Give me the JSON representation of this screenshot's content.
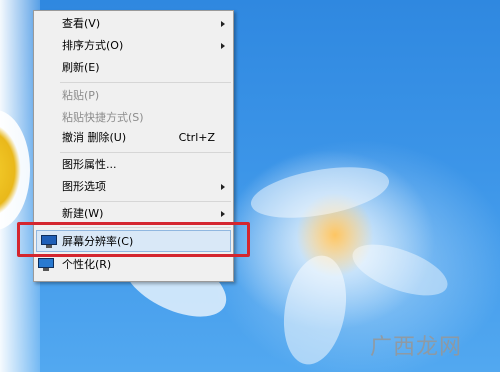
{
  "menu": {
    "items": [
      {
        "label": "查看(V)",
        "submenu": true
      },
      {
        "label": "排序方式(O)",
        "submenu": true
      },
      {
        "label": "刷新(E)"
      },
      {
        "label": "粘贴(P)",
        "disabled": true
      },
      {
        "label": "粘贴快捷方式(S)",
        "disabled": true
      },
      {
        "label": "撤消 删除(U)",
        "shortcut": "Ctrl+Z"
      },
      {
        "label": "图形属性..."
      },
      {
        "label": "图形选项",
        "submenu": true
      },
      {
        "label": "新建(W)",
        "submenu": true
      },
      {
        "label": "屏幕分辨率(C)",
        "icon": "monitor-icon",
        "highlighted": true
      },
      {
        "label": "个性化(R)",
        "icon": "personalize-icon"
      }
    ]
  },
  "watermark": "广西龙网",
  "colors": {
    "highlight_box": "#d4262f",
    "desktop_blue": "#3c95e8"
  }
}
